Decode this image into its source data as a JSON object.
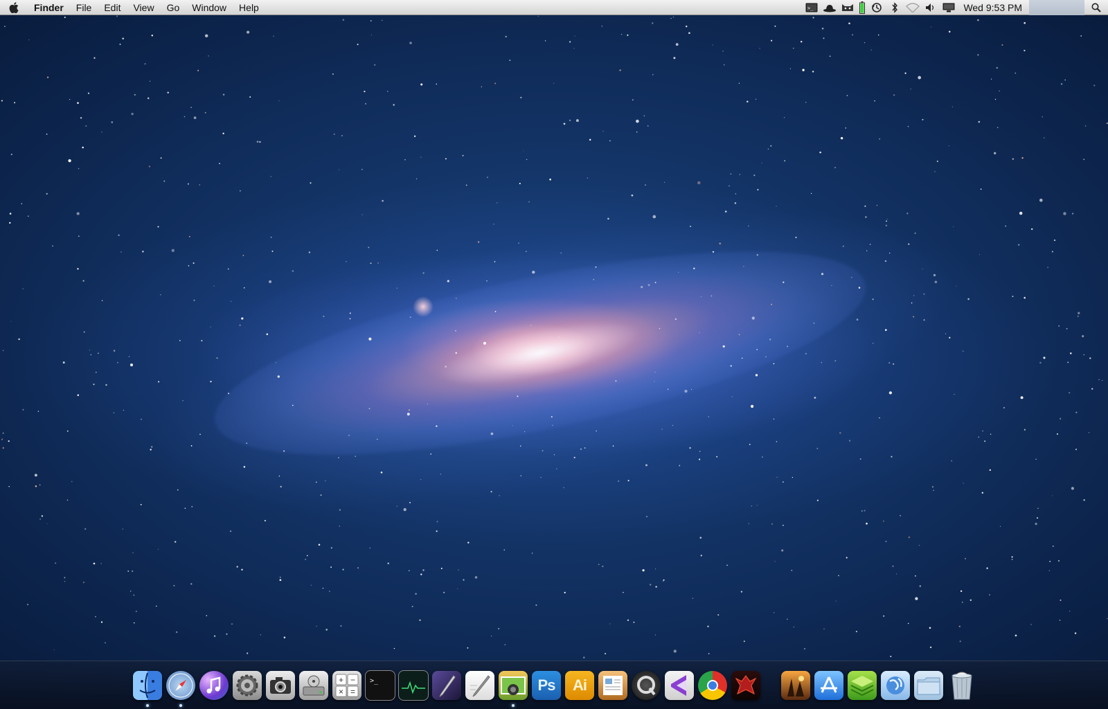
{
  "menubar": {
    "app_name": "Finder",
    "menus": [
      "File",
      "Edit",
      "View",
      "Go",
      "Window",
      "Help"
    ],
    "status_icons": [
      "terminal-icon",
      "hat-icon",
      "cat-icon",
      "battery-icon",
      "time-machine-icon",
      "bluetooth-icon",
      "wifi-icon",
      "volume-icon",
      "display-icon"
    ],
    "clock": "Wed 9:53 PM",
    "spotlight_icon": "magnifier-icon"
  },
  "dock": {
    "apps": [
      {
        "name": "Finder",
        "icon": "finder-icon",
        "running": true
      },
      {
        "name": "Safari",
        "icon": "safari-icon",
        "running": true
      },
      {
        "name": "iTunes",
        "icon": "itunes-icon",
        "running": false
      },
      {
        "name": "System Preferences",
        "icon": "system-preferences-icon",
        "running": false
      },
      {
        "name": "Image Capture",
        "icon": "camera-icon",
        "running": false
      },
      {
        "name": "Disk Utility",
        "icon": "disk-utility-icon",
        "running": false
      },
      {
        "name": "Calculator",
        "icon": "calculator-icon",
        "running": false
      },
      {
        "name": "Terminal",
        "icon": "terminal-app-icon",
        "running": false
      },
      {
        "name": "Activity Monitor",
        "icon": "activity-monitor-icon",
        "running": false
      },
      {
        "name": "Script Editor",
        "icon": "script-editor-icon",
        "running": false
      },
      {
        "name": "TextEdit",
        "icon": "textedit-icon",
        "running": false
      },
      {
        "name": "iPhoto",
        "icon": "iphoto-icon",
        "running": true
      },
      {
        "name": "Photoshop",
        "icon": "photoshop-icon",
        "label": "Ps",
        "running": false
      },
      {
        "name": "Illustrator",
        "icon": "illustrator-icon",
        "label": "Ai",
        "running": false
      },
      {
        "name": "Preview",
        "icon": "preview-icon",
        "running": false
      },
      {
        "name": "QuickTime",
        "icon": "quicktime-icon",
        "running": false
      },
      {
        "name": "Visual Studio",
        "icon": "visual-studio-icon",
        "running": false
      },
      {
        "name": "Chrome",
        "icon": "chrome-icon",
        "running": false
      },
      {
        "name": "Horde",
        "icon": "horde-icon",
        "running": false
      }
    ],
    "right": [
      {
        "name": "Photo Booth",
        "icon": "photo-booth-icon"
      },
      {
        "name": "App Store",
        "icon": "app-store-icon"
      },
      {
        "name": "Stacks",
        "icon": "stacks-icon"
      },
      {
        "name": "Network",
        "icon": "globe-folder-icon"
      },
      {
        "name": "Documents",
        "icon": "documents-folder-icon"
      },
      {
        "name": "Trash",
        "icon": "trash-icon"
      }
    ]
  },
  "colors": {
    "menubar_bg": "#e4e4e4",
    "desktop_bg": "#112f5f",
    "galaxy_core": "#f5afbe"
  }
}
